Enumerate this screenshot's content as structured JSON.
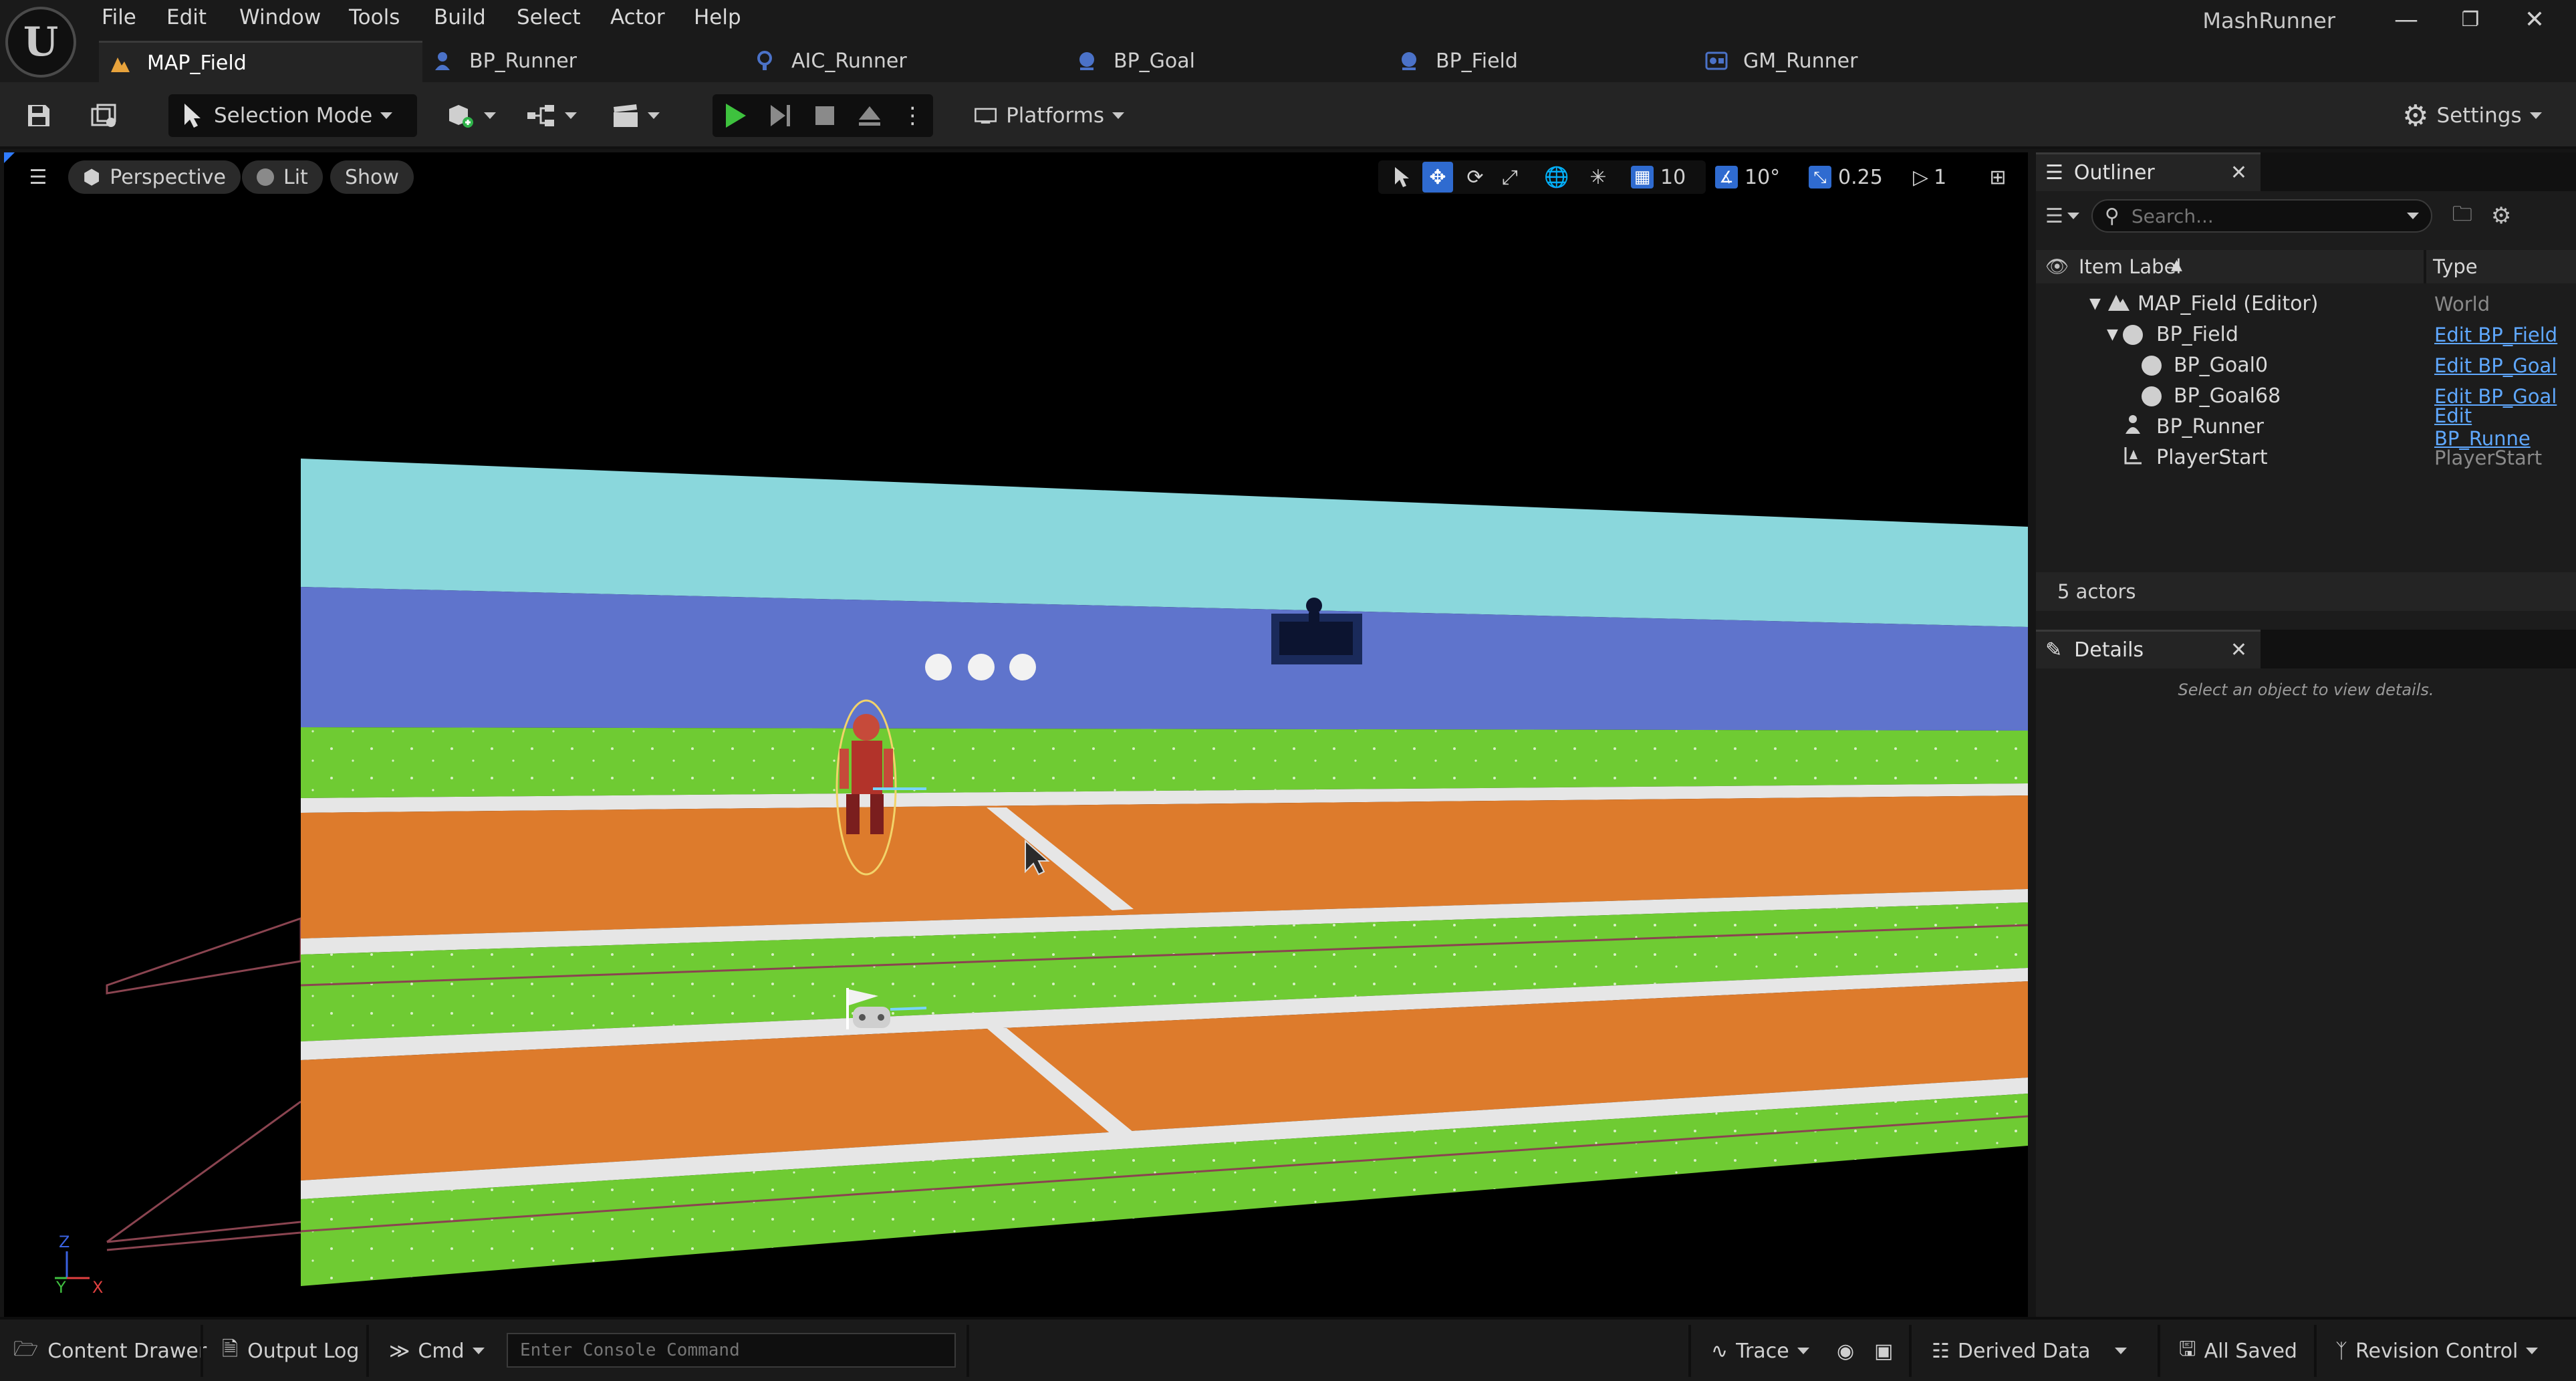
{
  "app": {
    "title": "MashRunner",
    "logo_letter": "U"
  },
  "menu": [
    "File",
    "Edit",
    "Window",
    "Tools",
    "Build",
    "Select",
    "Actor",
    "Help"
  ],
  "tabs": [
    {
      "label": "MAP_Field",
      "icon": "level-icon",
      "active": true
    },
    {
      "label": "BP_Runner",
      "icon": "blueprint-icon"
    },
    {
      "label": "AIC_Runner",
      "icon": "ai-controller-icon"
    },
    {
      "label": "BP_Goal",
      "icon": "blueprint-icon"
    },
    {
      "label": "BP_Field",
      "icon": "blueprint-icon"
    },
    {
      "label": "GM_Runner",
      "icon": "game-mode-icon"
    }
  ],
  "toolbar": {
    "selection_mode": "Selection Mode",
    "platforms": "Platforms",
    "settings": "Settings"
  },
  "viewport": {
    "perspective": "Perspective",
    "lit": "Lit",
    "show": "Show",
    "grid_snap": "10",
    "rotation_snap": "10°",
    "scale_snap": "0.25",
    "camera_speed": "1",
    "axis": {
      "z": "Z",
      "y": "Y",
      "x": "X"
    }
  },
  "outliner": {
    "title": "Outliner",
    "search_placeholder": "Search...",
    "col_label": "Item Label",
    "col_type": "Type",
    "rows": [
      {
        "label": "MAP_Field (Editor)",
        "type": "World",
        "indent": 0
      },
      {
        "label": "BP_Field",
        "type": "Edit BP_Field",
        "indent": 1
      },
      {
        "label": "BP_Goal0",
        "type": "Edit BP_Goal",
        "indent": 2
      },
      {
        "label": "BP_Goal68",
        "type": "Edit BP_Goal",
        "indent": 2
      },
      {
        "label": "BP_Runner",
        "type": "Edit BP_Runne",
        "indent": 1
      },
      {
        "label": "PlayerStart",
        "type": "PlayerStart",
        "indent": 1
      }
    ],
    "actor_count": "5 actors"
  },
  "details": {
    "title": "Details",
    "empty_message": "Select an object to view details."
  },
  "statusbar": {
    "content_drawer": "Content Drawer",
    "output_log": "Output Log",
    "cmd": "Cmd",
    "console_placeholder": "Enter Console Command",
    "trace": "Trace",
    "derived_data": "Derived Data",
    "all_saved": "All Saved",
    "revision_control": "Revision Control"
  },
  "colors": {
    "sky": "#8ad7dc",
    "wall": "#5f74cc",
    "grass": "#6fcb33",
    "track": "#dd7b2c",
    "line": "#e6e6e6",
    "link": "#5fa8ff"
  }
}
